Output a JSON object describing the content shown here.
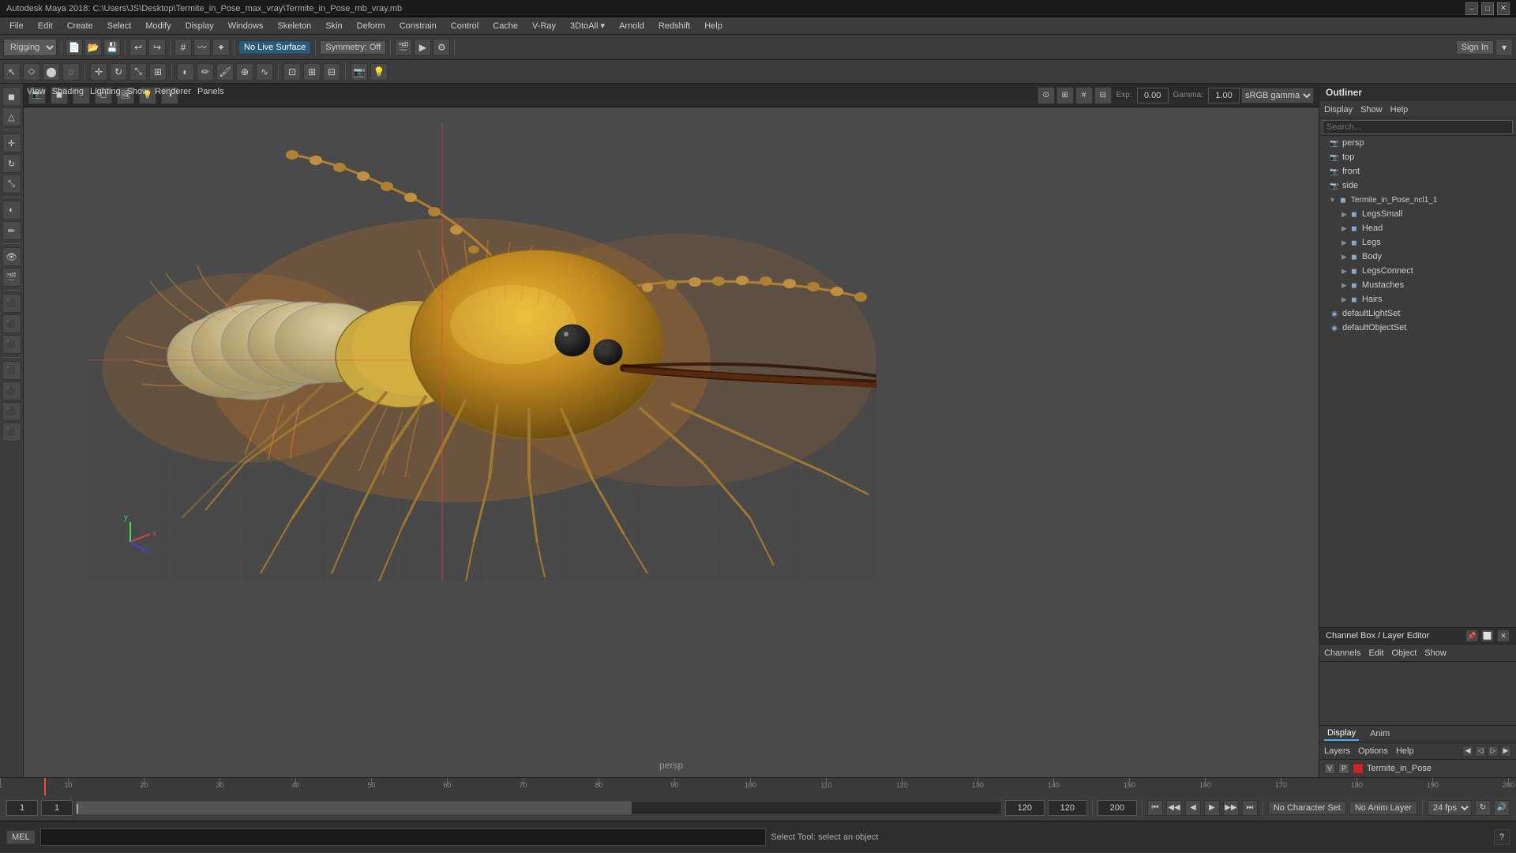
{
  "titlebar": {
    "title": "Autodesk Maya 2018: C:\\Users\\JS\\Desktop\\Termite_in_Pose_max_vray\\Termite_in_Pose_mb_vray.mb",
    "min": "–",
    "max": "□",
    "close": "✕"
  },
  "menubar": {
    "items": [
      "File",
      "Edit",
      "Create",
      "Select",
      "Modify",
      "Display",
      "Windows",
      "Skeleton",
      "Skin",
      "Deform",
      "Constrain",
      "Control",
      "Cache",
      "V-Ray",
      "3DtoAll ▾",
      "Arnold",
      "Redshift",
      "Help"
    ]
  },
  "toolbar1": {
    "rigging_label": "Rigging",
    "no_live_surface": "No Live Surface",
    "symmetry_off": "Symmetry: Off",
    "sign_in": "Sign In"
  },
  "viewport": {
    "menus": [
      "View",
      "Shading",
      "Lighting",
      "Show",
      "Renderer",
      "Panels"
    ],
    "label": "persp",
    "gamma_label": "sRGB gamma",
    "exposure_val": "0.00",
    "gain_val": "1.00"
  },
  "outliner": {
    "header": "Outliner",
    "menus": [
      "Display",
      "Show",
      "Help"
    ],
    "search_placeholder": "Search...",
    "tree": [
      {
        "label": "persp",
        "indent": 0,
        "type": "camera",
        "icon": "📷"
      },
      {
        "label": "top",
        "indent": 0,
        "type": "camera",
        "icon": "📷"
      },
      {
        "label": "front",
        "indent": 0,
        "type": "camera",
        "icon": "📷"
      },
      {
        "label": "side",
        "indent": 0,
        "type": "camera",
        "icon": "📷"
      },
      {
        "label": "Termite_in_Pose_ncl1_1",
        "indent": 0,
        "type": "group",
        "icon": "▸",
        "expanded": true
      },
      {
        "label": "LegsSmall",
        "indent": 1,
        "type": "mesh",
        "icon": "□"
      },
      {
        "label": "Head",
        "indent": 1,
        "type": "mesh",
        "icon": "□"
      },
      {
        "label": "Legs",
        "indent": 1,
        "type": "mesh",
        "icon": "□"
      },
      {
        "label": "Body",
        "indent": 1,
        "type": "mesh",
        "icon": "□"
      },
      {
        "label": "LegsConnect",
        "indent": 1,
        "type": "mesh",
        "icon": "□"
      },
      {
        "label": "Mustaches",
        "indent": 1,
        "type": "mesh",
        "icon": "□"
      },
      {
        "label": "Hairs",
        "indent": 1,
        "type": "mesh",
        "icon": "□"
      },
      {
        "label": "defaultLightSet",
        "indent": 0,
        "type": "set",
        "icon": "◉"
      },
      {
        "label": "defaultObjectSet",
        "indent": 0,
        "type": "set",
        "icon": "◉"
      }
    ]
  },
  "channelbox": {
    "header": "Channel Box / Layer Editor",
    "menus": [
      "Channels",
      "Edit",
      "Object",
      "Show"
    ]
  },
  "display_panel": {
    "tabs": [
      "Display",
      "Anim"
    ],
    "layer_menus": [
      "Layers",
      "Options",
      "Help"
    ],
    "layer": {
      "v": "V",
      "p": "P",
      "name": "Termite_in_Pose"
    }
  },
  "timeline": {
    "start_frame": "1",
    "end_frame": "120",
    "current_frame": "1",
    "range_start": "1",
    "range_end": "120",
    "anim_end": "200",
    "fps": "24 fps",
    "ticks": [
      1,
      10,
      20,
      30,
      40,
      50,
      60,
      70,
      80,
      90,
      100,
      110,
      120,
      130,
      140,
      150,
      160,
      170,
      180,
      190,
      200
    ]
  },
  "playback": {
    "buttons": [
      "⏮",
      "⏭",
      "◀",
      "▶",
      "▶▶",
      "⏭⏭"
    ],
    "no_character": "No Character Set",
    "no_anim_layer": "No Anim Layer"
  },
  "statusbar": {
    "mel_label": "MEL",
    "status_text": "Select Tool: select an object"
  },
  "icons": {
    "arrow_right": "▶",
    "arrow_down": "▼",
    "move": "✛",
    "rotate": "↻",
    "scale": "⤡",
    "select": "↖",
    "paint": "✏",
    "camera": "📷"
  }
}
